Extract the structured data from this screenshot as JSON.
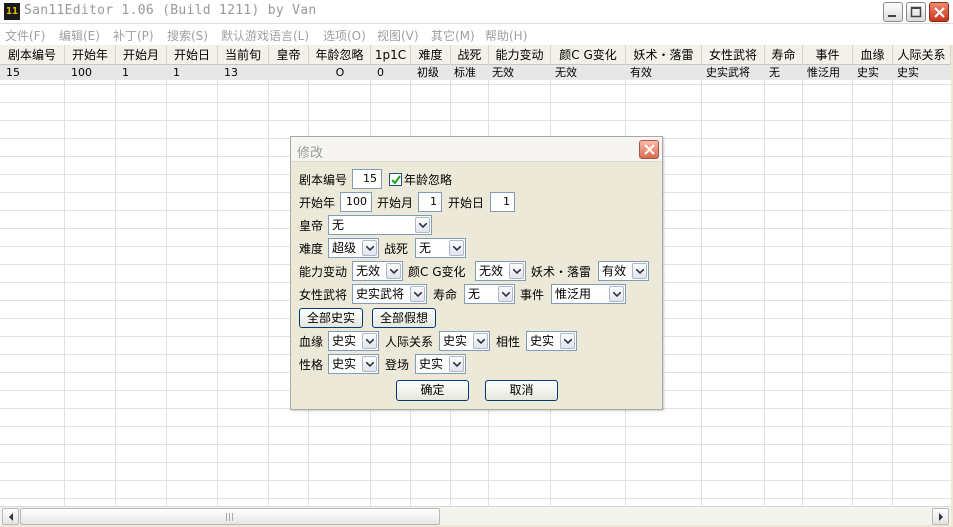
{
  "window": {
    "title": "San11Editor 1.06 (Build 1211) by Van",
    "icon_text": "11"
  },
  "menu": [
    "文件(F)",
    "编辑(E)",
    "补丁(P)",
    "搜索(S)",
    "默认游戏语言(L)",
    "选项(O)",
    "视图(V)",
    "其它(M)",
    "帮助(H)"
  ],
  "grid": {
    "columns": [
      "剧本编号",
      "开始年",
      "开始月",
      "开始日",
      "当前旬",
      "皇帝",
      "年龄忽略",
      "1p1C",
      "难度",
      "战死",
      "能力变动",
      "颜C G变化",
      "妖术・落雷",
      "女性武将",
      "寿命",
      "事件",
      "血缘",
      "人际关系"
    ],
    "row": [
      "15",
      "100",
      "1",
      "1",
      "13",
      "",
      "O",
      "0",
      "初级",
      "标准",
      "无效",
      "无效",
      "有效",
      "史实武将",
      "无",
      "惟泛用",
      "史实",
      "史实"
    ]
  },
  "dialog": {
    "title": "修改",
    "scenario_label": "剧本编号",
    "scenario_value": "15",
    "age_ignore_label": "年龄忽略",
    "age_ignore_checked": true,
    "start_year_label": "开始年",
    "start_year_value": "100",
    "start_month_label": "开始月",
    "start_month_value": "1",
    "start_day_label": "开始日",
    "start_day_value": "1",
    "emperor_label": "皇帝",
    "emperor_value": "无",
    "difficulty_label": "难度",
    "difficulty_value": "超级",
    "death_label": "战死",
    "death_value": "无",
    "ability_label": "能力变动",
    "ability_value": "无效",
    "face_cg_label": "颜C G变化",
    "face_cg_value": "无效",
    "magic_label": "妖术・落雷",
    "magic_value": "有效",
    "female_label": "女性武将",
    "female_value": "史实武将",
    "lifespan_label": "寿命",
    "lifespan_value": "无",
    "event_label": "事件",
    "event_value": "惟泛用",
    "all_historical_label": "全部史实",
    "all_fictional_label": "全部假想",
    "blood_label": "血缘",
    "blood_value": "史实",
    "relations_label": "人际关系",
    "relations_value": "史实",
    "affinity_label": "相性",
    "affinity_value": "史实",
    "personality_label": "性格",
    "personality_value": "史实",
    "appearance_label": "登场",
    "appearance_value": "史实",
    "ok_label": "确定",
    "cancel_label": "取消"
  },
  "colors": {
    "close_button": "#d04020",
    "input_border": "#7f9db9",
    "button_border": "#003c74",
    "checkbox_mark": "#21a121"
  }
}
